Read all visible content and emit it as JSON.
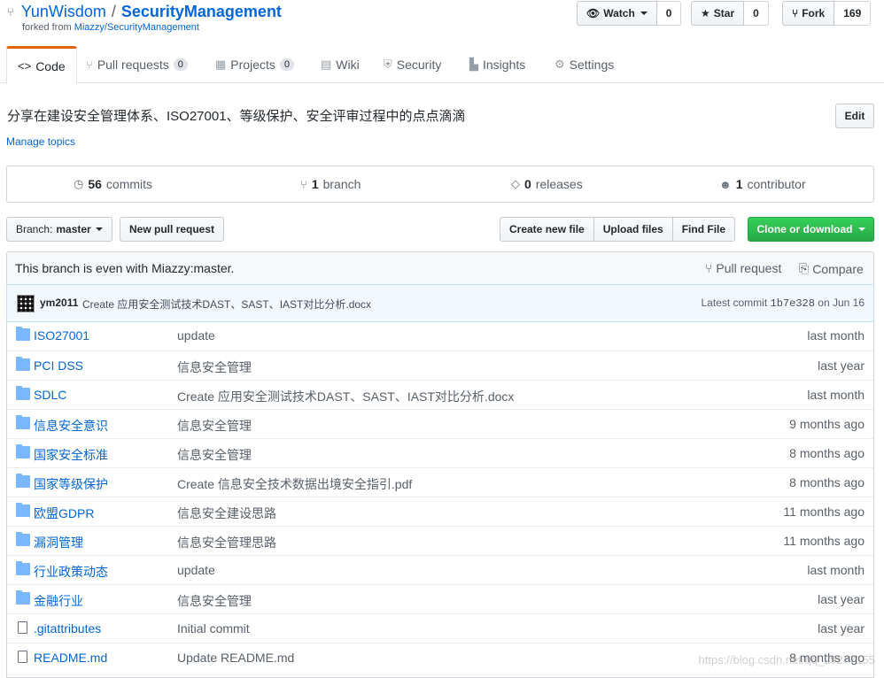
{
  "repo": {
    "owner": "YunWisdom",
    "separator": "/",
    "name": "SecurityManagement",
    "forked_prefix": "forked from ",
    "forked_from": "Miazzy/SecurityManagement"
  },
  "actions": {
    "watch_label": "Watch",
    "watch_count": "0",
    "star_label": "Star",
    "star_count": "0",
    "fork_label": "Fork",
    "fork_count": "169"
  },
  "tabs": [
    {
      "label": "Code",
      "icon": "code-icon"
    },
    {
      "label": "Pull requests",
      "count": "0",
      "icon": "pull-request-icon"
    },
    {
      "label": "Projects",
      "count": "0",
      "icon": "project-icon"
    },
    {
      "label": "Wiki",
      "icon": "book-icon"
    },
    {
      "label": "Security",
      "icon": "shield-icon"
    },
    {
      "label": "Insights",
      "icon": "graph-icon"
    },
    {
      "label": "Settings",
      "icon": "gear-icon"
    }
  ],
  "description": "分享在建设安全管理体系、ISO27001、等级保护、安全评审过程中的点点滴滴",
  "manage_topics": "Manage topics",
  "edit_label": "Edit",
  "summary": {
    "commits_count": "56",
    "commits_label": "commits",
    "branch_count": "1",
    "branch_label": "branch",
    "releases_count": "0",
    "releases_label": "releases",
    "contributor_count": "1",
    "contributor_label": "contributor"
  },
  "toolbar": {
    "branch_prefix": "Branch:",
    "branch_name": "master",
    "new_pr": "New pull request",
    "create_file": "Create new file",
    "upload_files": "Upload files",
    "find_file": "Find File",
    "clone": "Clone or download"
  },
  "branch_status": {
    "text": "This branch is even with Miazzy:master.",
    "pull_request": "Pull request",
    "compare": "Compare"
  },
  "latest_commit": {
    "author": "ym2011",
    "message": "Create 应用安全测试技术DAST、SAST、IAST对比分析.docx",
    "prefix": "Latest commit",
    "sha": "1b7e328",
    "date": "on Jun 16"
  },
  "files": [
    {
      "type": "dir",
      "name": "ISO27001",
      "message": "update",
      "age": "last month"
    },
    {
      "type": "dir",
      "name": "PCI DSS",
      "message": "信息安全管理",
      "age": "last year"
    },
    {
      "type": "dir",
      "name": "SDLC",
      "message": "Create 应用安全测试技术DAST、SAST、IAST对比分析.docx",
      "age": "last month"
    },
    {
      "type": "dir",
      "name": "信息安全意识",
      "message": "信息安全管理",
      "age": "9 months ago"
    },
    {
      "type": "dir",
      "name": "国家安全标准",
      "message": "信息安全管理",
      "age": "8 months ago"
    },
    {
      "type": "dir",
      "name": "国家等级保护",
      "message": "Create 信息安全技术数据出境安全指引.pdf",
      "age": "8 months ago"
    },
    {
      "type": "dir",
      "name": "欧盟GDPR",
      "message": "信息安全建设思路",
      "age": "11 months ago"
    },
    {
      "type": "dir",
      "name": "漏洞管理",
      "message": "信息安全管理思路",
      "age": "11 months ago"
    },
    {
      "type": "dir",
      "name": "行业政策动态",
      "message": "update",
      "age": "last month"
    },
    {
      "type": "dir",
      "name": "金融行业",
      "message": "信息安全管理",
      "age": "last year"
    },
    {
      "type": "file",
      "name": ".gitattributes",
      "message": "Initial commit",
      "age": "last year"
    },
    {
      "type": "file",
      "name": "README.md",
      "message": "Update README.md",
      "age": "8 months ago"
    }
  ],
  "watermark": "https://blog.csdn.net/qq_29277155"
}
